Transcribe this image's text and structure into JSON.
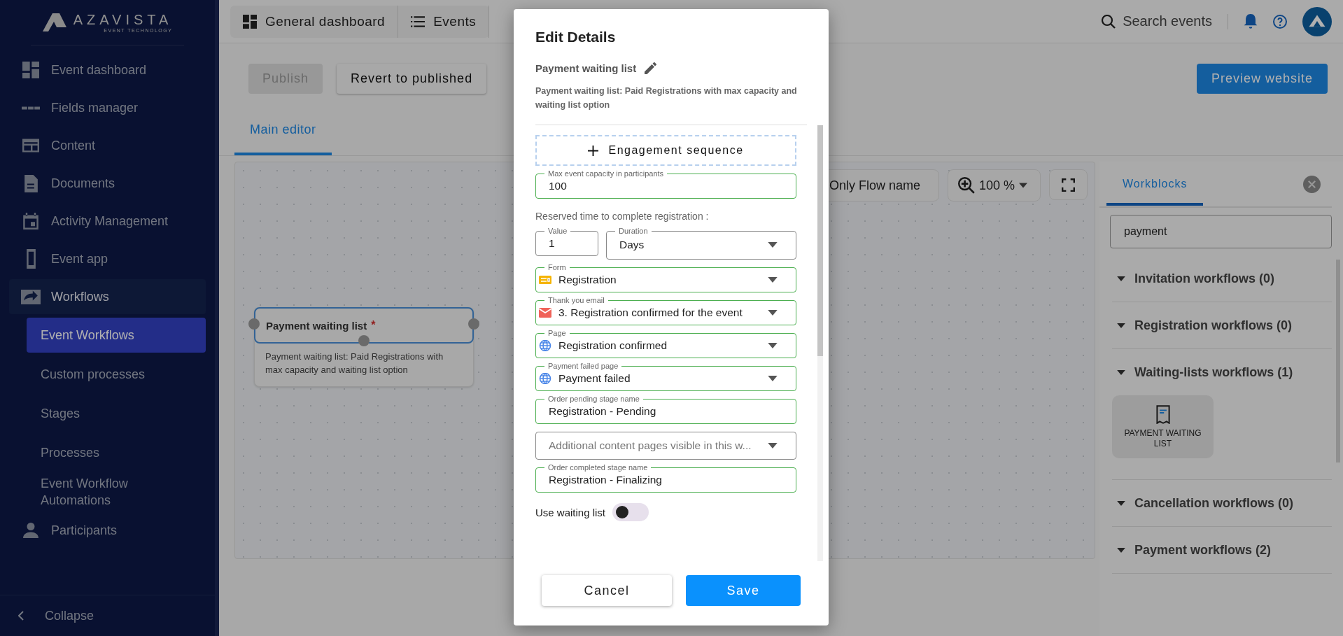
{
  "sidebar": {
    "logo": {
      "name": "AZAVISTA",
      "tagline": "EVENT TECHNOLOGY"
    },
    "items": [
      {
        "label": "Event dashboard",
        "selected": false
      },
      {
        "label": "Fields manager",
        "selected": false
      },
      {
        "label": "Content",
        "selected": false
      },
      {
        "label": "Documents",
        "selected": false
      },
      {
        "label": "Activity Management",
        "selected": false
      },
      {
        "label": "Event app",
        "selected": false
      },
      {
        "label": "Workflows",
        "selected": true,
        "children": [
          {
            "label": "Event Workflows",
            "selected": true
          },
          {
            "label": "Custom processes",
            "selected": false
          },
          {
            "label": "Stages",
            "selected": false
          },
          {
            "label": "Processes",
            "selected": false
          },
          {
            "label": "Event Workflow Automations",
            "selected": false
          }
        ]
      },
      {
        "label": "Participants",
        "selected": false
      }
    ],
    "collapse": "Collapse"
  },
  "topbar": {
    "nav": [
      {
        "label": "General dashboard"
      },
      {
        "label": "Events"
      }
    ],
    "search": "Search events"
  },
  "toolbar": {
    "publish": {
      "label": "Publish",
      "disabled": true
    },
    "revert": {
      "label": "Revert to published",
      "disabled": false
    },
    "preview": {
      "label": "Preview website",
      "disabled": false
    }
  },
  "tabs": [
    {
      "label": "Main editor",
      "selected": true
    }
  ],
  "canvas": {
    "flow_name_toggle": "Only Flow name",
    "zoom": "100 %",
    "node": {
      "title": "Payment waiting list",
      "required_mark": "*",
      "selected": true,
      "description": "Payment waiting list: Paid Registrations with max capacity and waiting list option"
    }
  },
  "workblocks": {
    "tabs": [
      {
        "label": "Workblocks",
        "selected": true
      }
    ],
    "search": "payment",
    "groups": [
      {
        "label": "Invitation workflows (0)",
        "expanded": true
      },
      {
        "label": "Registration workflows (0)",
        "expanded": true
      },
      {
        "label": "Waiting-lists workflows (1)",
        "expanded": true,
        "items": [
          {
            "label": "PAYMENT WAITING LIST"
          }
        ]
      },
      {
        "label": "Cancellation workflows (0)",
        "expanded": true
      },
      {
        "label": "Payment workflows (2)",
        "expanded": true
      }
    ]
  },
  "dialog": {
    "title": "Edit Details",
    "name": "Payment waiting list",
    "description": "Payment waiting list: Paid Registrations with max capacity and waiting list option",
    "add_button": "Engagement sequence",
    "fields": [
      {
        "kind": "text",
        "label": "Max event capacity in participants",
        "value": "100",
        "valid": true
      },
      {
        "kind": "heading",
        "label": "Reserved time to complete registration :"
      },
      {
        "kind": "pair",
        "items": [
          {
            "kind": "text",
            "label": "Value",
            "value": "1",
            "valid": false
          },
          {
            "kind": "select",
            "label": "Duration",
            "value": "Days",
            "valid": false
          }
        ]
      },
      {
        "kind": "select",
        "label": "Form",
        "value": "Registration",
        "valid": true
      },
      {
        "kind": "select",
        "label": "Thank you email",
        "value": "3. Registration confirmed for the event",
        "valid": true
      },
      {
        "kind": "select",
        "label": "Page",
        "value": "Registration confirmed",
        "valid": true
      },
      {
        "kind": "select",
        "label": "Payment failed page",
        "value": "Payment failed",
        "valid": true
      },
      {
        "kind": "text",
        "label": "Order pending stage name",
        "value": "Registration - Pending",
        "valid": true
      },
      {
        "kind": "select",
        "placeholder": "Additional content pages visible in this w...",
        "valid": false
      },
      {
        "kind": "text",
        "label": "Order completed stage name",
        "value": "Registration - Finalizing",
        "valid": true
      },
      {
        "kind": "toggle",
        "label": "Use waiting list",
        "on": false
      }
    ],
    "buttons": [
      {
        "kind": "secondary",
        "label": "Cancel"
      },
      {
        "kind": "primary",
        "label": "Save"
      }
    ]
  }
}
